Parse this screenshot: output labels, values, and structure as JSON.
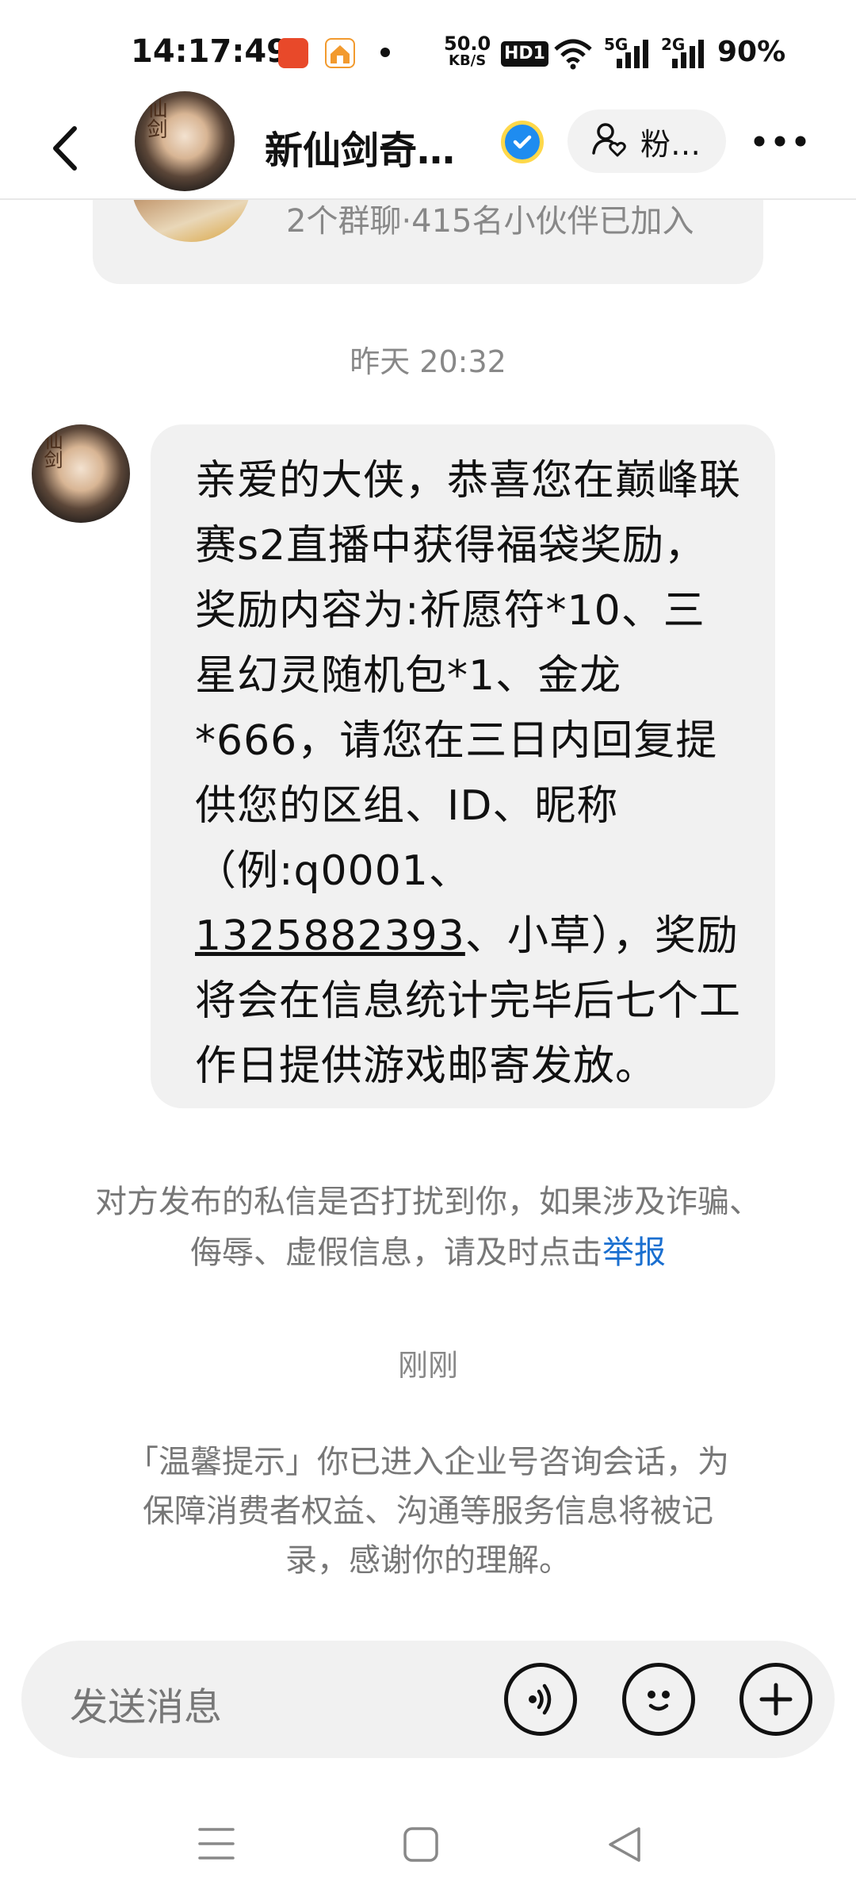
{
  "status_bar": {
    "time": "14:17:49",
    "net_speed_value": "50.0",
    "net_speed_unit": "KB/S",
    "hd_label": "HD1",
    "sim1": "5G",
    "sim2": "2G",
    "battery": "90%"
  },
  "header": {
    "title": "新仙剑奇…",
    "fans_label": "粉…"
  },
  "group_card": {
    "text": "2个群聊·415名小伙伴已加入"
  },
  "chat": {
    "timestamp_1": "昨天 20:32",
    "message_part1": "亲爱的大侠，恭喜您在巅峰联赛s2直播中获得福袋奖励，奖励内容为:祈愿符*10、三星幻灵随机包*1、金龙*666，请您在三日内回复提供您的区组、ID、昵称（例:q0001、",
    "message_phone": "1325882393",
    "message_part2": "、小草），奖励将会在信息统计完毕后七个工作日提供游戏邮寄发放。",
    "notice_text": "对方发布的私信是否打扰到你，如果涉及诈骗、侮辱、虚假信息，请及时点击",
    "notice_link": "举报",
    "timestamp_2": "刚刚",
    "tip_text": "「温馨提示」你已进入企业号咨询会话，为保障消费者权益、沟通等服务信息将被记录，感谢你的理解。"
  },
  "input": {
    "placeholder": "发送消息"
  },
  "colors": {
    "bubble_bg": "#f1f1f1",
    "link_blue": "#1a6fd0",
    "verified_blue": "#1e8cf0",
    "muted_text": "#888888"
  },
  "icons": [
    "back-arrow-icon",
    "verified-icon",
    "user-heart-icon",
    "more-icon",
    "voice-icon",
    "emoji-icon",
    "plus-icon",
    "menu-icon",
    "home-icon",
    "back-triangle-icon"
  ]
}
